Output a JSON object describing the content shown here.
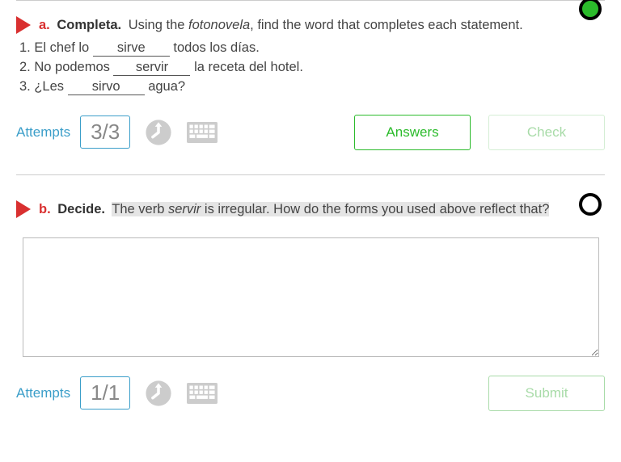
{
  "exerciseA": {
    "letter": "a.",
    "title": "Completa.",
    "instruction_pre": " Using the ",
    "instruction_italic": "fotonovela",
    "instruction_post": ", find the word that completes each statement.",
    "q1_pre": "1. El chef lo ",
    "q1_blank": "sirve",
    "q1_post": " todos los días.",
    "q2_pre": "2. No podemos ",
    "q2_blank": "servir",
    "q2_post": " la receta del hotel.",
    "q3_pre": "3. ¿Les ",
    "q3_blank": "sirvo",
    "q3_post": " agua?",
    "attempts_label": "Attempts",
    "attempts_value": "3/3",
    "answers_btn": "Answers",
    "check_btn": "Check"
  },
  "exerciseB": {
    "letter": "b.",
    "title": "Decide.",
    "instruction_pre": " The verb ",
    "instruction_italic": "servir",
    "instruction_post": " is irregular. How do the forms you used above reflect that?",
    "attempts_label": "Attempts",
    "attempts_value": "1/1",
    "submit_btn": "Submit"
  }
}
